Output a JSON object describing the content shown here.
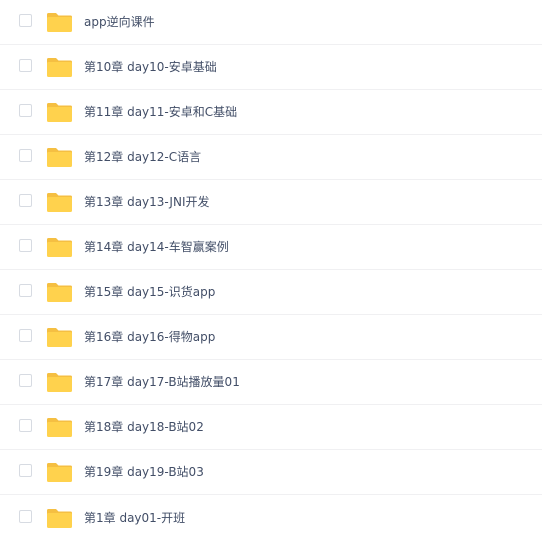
{
  "colors": {
    "folder_back": "#f5bf42",
    "folder_front": "#ffd24d",
    "text": "#424e67",
    "divider": "#f0f0f2"
  },
  "items": [
    {
      "name": "app逆向课件",
      "icon": "folder-icon"
    },
    {
      "name": "第10章 day10-安卓基础",
      "icon": "folder-icon"
    },
    {
      "name": "第11章 day11-安卓和C基础",
      "icon": "folder-icon"
    },
    {
      "name": "第12章 day12-C语言",
      "icon": "folder-icon"
    },
    {
      "name": "第13章 day13-JNI开发",
      "icon": "folder-icon"
    },
    {
      "name": "第14章 day14-车智赢案例",
      "icon": "folder-icon"
    },
    {
      "name": "第15章 day15-识货app",
      "icon": "folder-icon"
    },
    {
      "name": "第16章 day16-得物app",
      "icon": "folder-icon"
    },
    {
      "name": "第17章 day17-B站播放量01",
      "icon": "folder-icon"
    },
    {
      "name": "第18章 day18-B站02",
      "icon": "folder-icon"
    },
    {
      "name": "第19章 day19-B站03",
      "icon": "folder-icon"
    },
    {
      "name": "第1章 day01-开班",
      "icon": "folder-icon"
    }
  ]
}
